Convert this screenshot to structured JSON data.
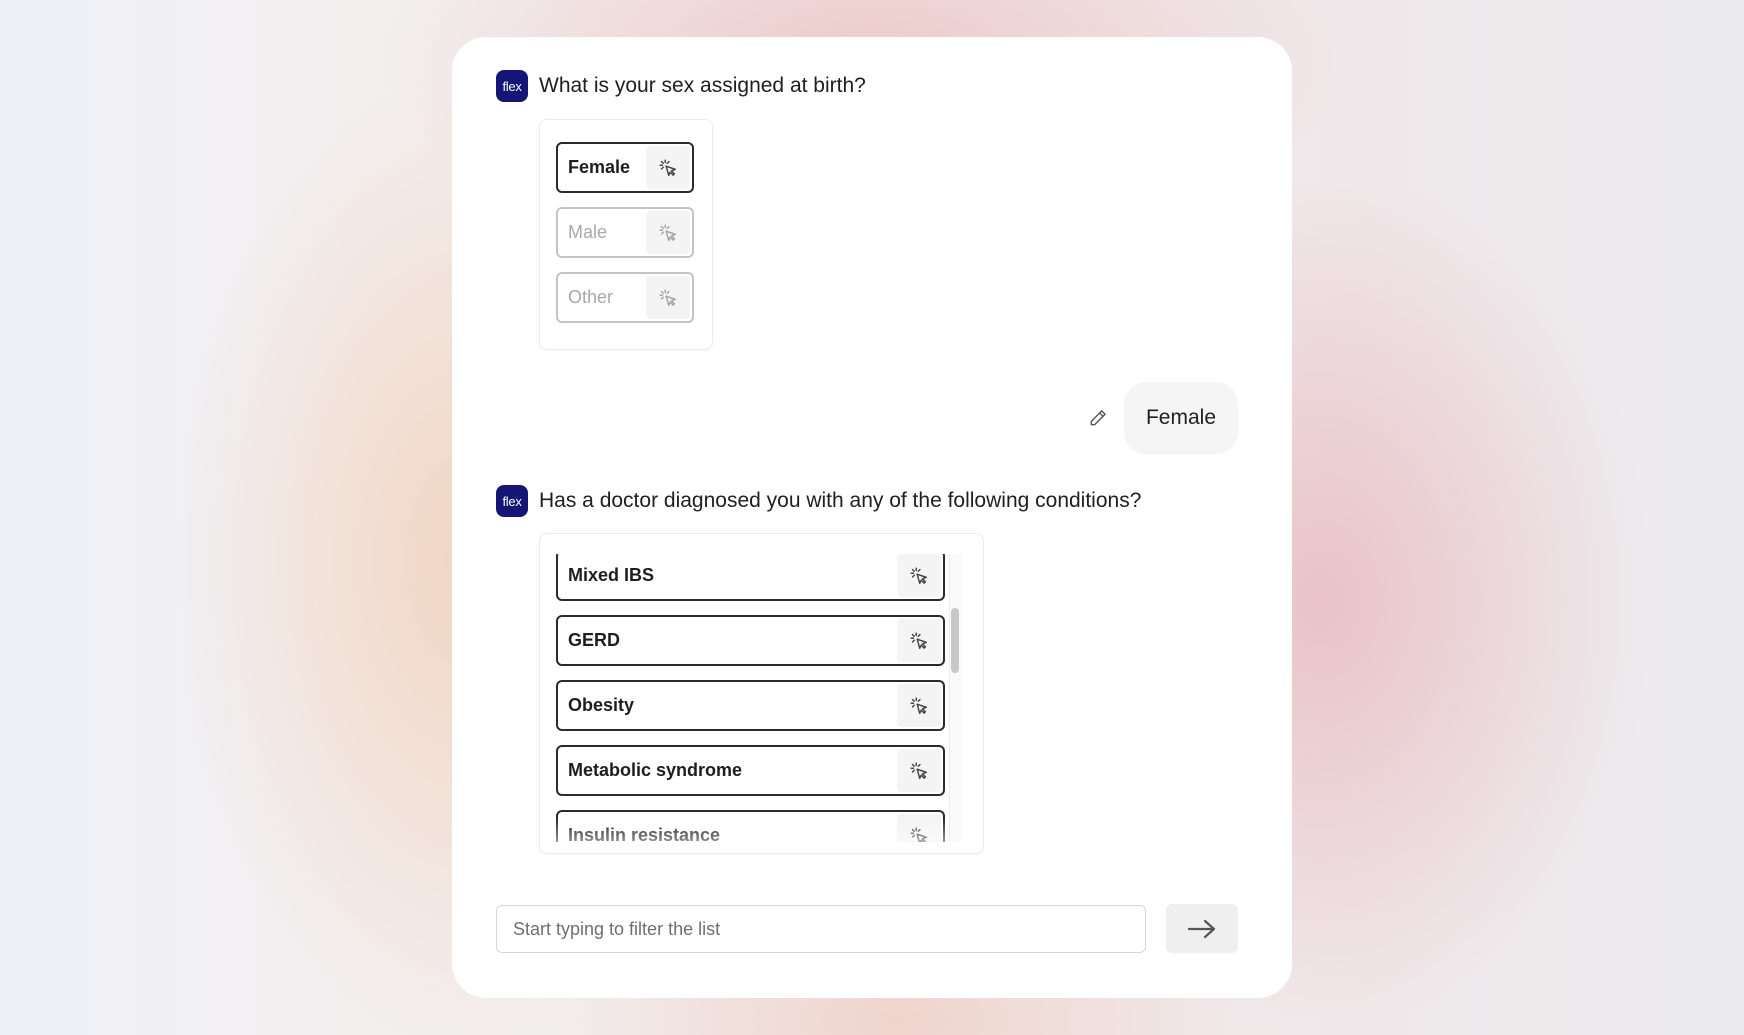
{
  "brand": {
    "logo_text": "flex"
  },
  "question1": {
    "text": "What is your sex assigned at birth?",
    "options": [
      {
        "label": "Female",
        "state": "selected"
      },
      {
        "label": "Male",
        "state": "dimmed"
      },
      {
        "label": "Other",
        "state": "dimmed"
      }
    ]
  },
  "answer1": {
    "text": "Female",
    "edit_icon": "pencil-icon"
  },
  "question2": {
    "text": "Has a doctor diagnosed you with any of the following conditions?",
    "options": [
      {
        "label": "Mixed IBS"
      },
      {
        "label": "GERD"
      },
      {
        "label": "Obesity"
      },
      {
        "label": "Metabolic syndrome"
      },
      {
        "label": "Insulin resistance"
      }
    ]
  },
  "filter": {
    "placeholder": "Start typing to filter the list",
    "value": ""
  },
  "submit": {
    "icon": "arrow-right-icon"
  },
  "colors": {
    "brand": "#151575",
    "card": "#ffffff",
    "border_active": "#2b2b2b",
    "border_muted": "#c4c4c4"
  }
}
